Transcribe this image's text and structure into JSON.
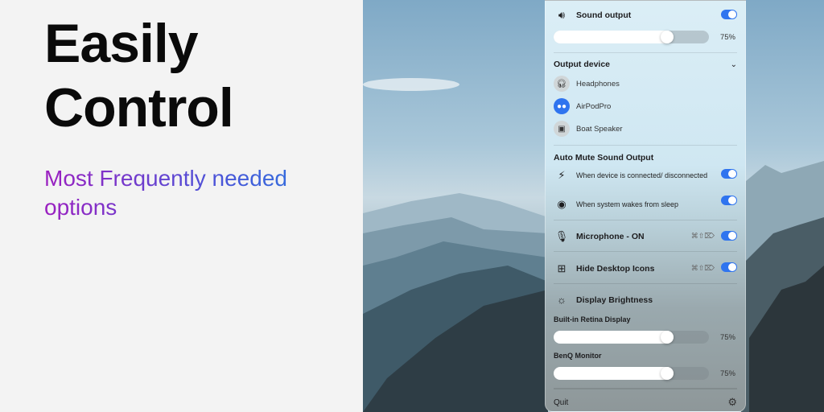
{
  "hero": {
    "line1": "Easily",
    "line2": "Control",
    "subtitle": "Most Frequently needed options"
  },
  "panel": {
    "sound": {
      "label": "Sound output",
      "enabled": true,
      "volume_percent": 75,
      "volume_text": "75%"
    },
    "output_device": {
      "label": "Output device",
      "devices": [
        {
          "name": "Headphones",
          "icon": "headphones-icon",
          "selected": false
        },
        {
          "name": "AirPodPro",
          "icon": "airpods-icon",
          "selected": true
        },
        {
          "name": "Boat Speaker",
          "icon": "speaker-icon",
          "selected": false
        }
      ]
    },
    "auto_mute": {
      "label": "Auto Mute Sound Output",
      "options": [
        {
          "label": "When device is connected/ disconnected",
          "enabled": true
        },
        {
          "label": "When system wakes from sleep",
          "enabled": true
        }
      ]
    },
    "microphone": {
      "label": "Microphone - ON",
      "shortcut": "⌘⇧⌦",
      "enabled": true
    },
    "desktop_icons": {
      "label": "Hide Desktop Icons",
      "shortcut": "⌘⇧⌦",
      "enabled": true
    },
    "brightness": {
      "label": "Display Brightness",
      "displays": [
        {
          "name": "Built-in Retina Display",
          "percent": 75,
          "text": "75%"
        },
        {
          "name": "BenQ Monitor",
          "percent": 75,
          "text": "75%"
        }
      ]
    },
    "footer": {
      "quit": "Quit"
    },
    "colors": {
      "accent": "#2f74ef"
    }
  }
}
